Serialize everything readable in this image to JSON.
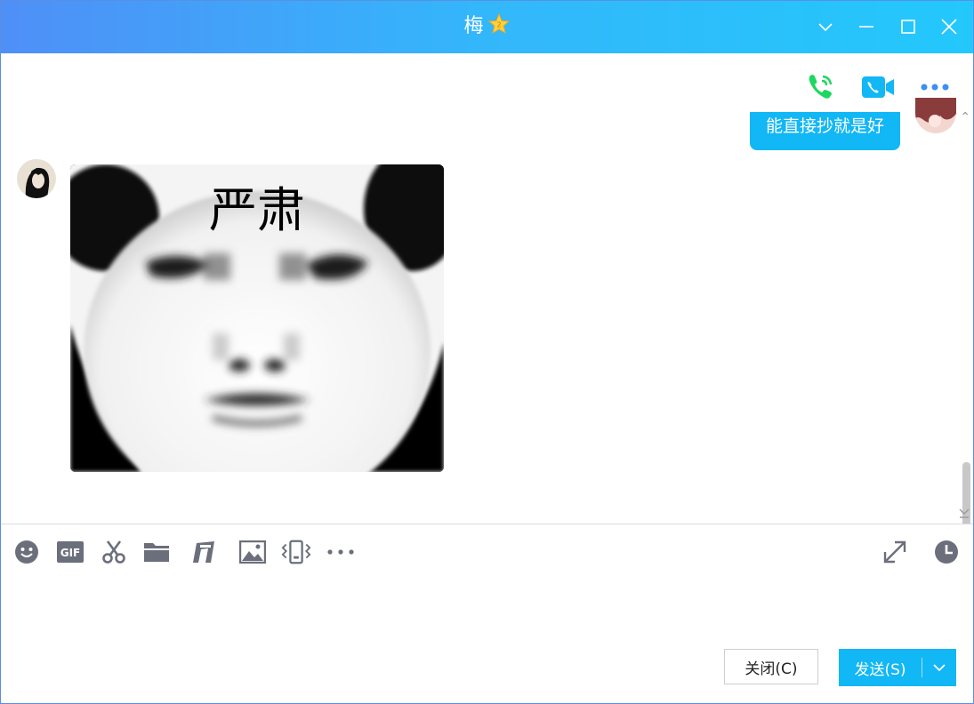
{
  "window": {
    "title": "梅",
    "badge_icon": "star-level-icon",
    "controls": [
      "dropdown-icon",
      "minimize-icon",
      "maximize-icon",
      "close-icon"
    ]
  },
  "header_actions": [
    {
      "name": "voice-call-icon",
      "color": "#1ed760"
    },
    {
      "name": "video-call-icon",
      "color": "#12b7f5"
    },
    {
      "name": "more-icon",
      "color": "#3a8ef6"
    }
  ],
  "messages": [
    {
      "side": "right",
      "type": "text",
      "text": "能直接抄就是好"
    },
    {
      "side": "left",
      "type": "sticker",
      "caption": "严肃"
    }
  ],
  "toolbar": {
    "gif_label": "GIF",
    "icons": [
      "emoji-icon",
      "gif-icon",
      "screenshot-icon",
      "folder-icon",
      "music-icon",
      "image-icon",
      "shake-icon",
      "more-icon"
    ],
    "right_icons": [
      "expand-icon",
      "history-icon"
    ]
  },
  "input": {
    "value": "",
    "placeholder": ""
  },
  "buttons": {
    "close_label": "关闭(C)",
    "send_label": "发送(S)"
  },
  "colors": {
    "accent": "#12b7f5",
    "titlebar_start": "#4f8ff7",
    "titlebar_end": "#23c8fb",
    "toolbar_icon": "#6b6f7b"
  }
}
